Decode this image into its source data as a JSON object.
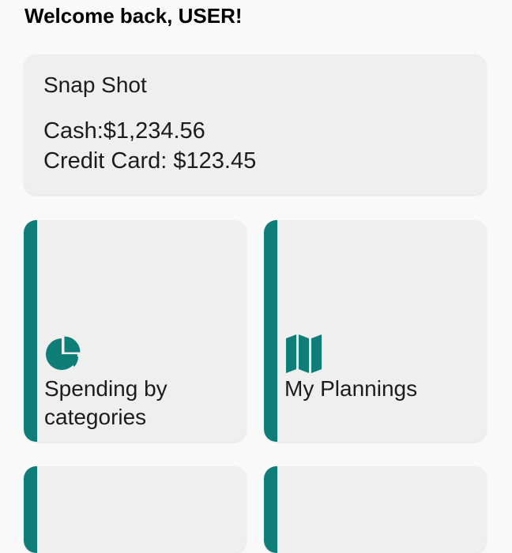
{
  "header": {
    "welcome": "Welcome back, USER!"
  },
  "snapshot": {
    "title": "Snap Shot",
    "cash": "Cash:$1,234.56",
    "credit_card": "Credit Card: $123.45"
  },
  "tiles": [
    {
      "label_line1": "Spending by",
      "label_line2": "categories",
      "icon": "pie-chart-icon"
    },
    {
      "label": "My Plannings",
      "icon": "map-icon"
    },
    {
      "label": "",
      "icon": ""
    },
    {
      "label": "",
      "icon": ""
    }
  ],
  "colors": {
    "accent": "#0f7d78",
    "card_background": "#efefef",
    "page_background": "#f9f9f9"
  }
}
